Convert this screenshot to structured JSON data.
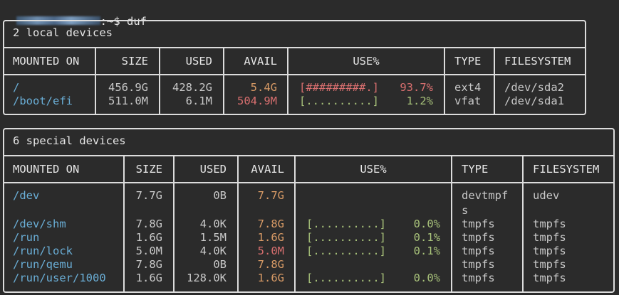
{
  "prompt": {
    "suffix": ":~$ duf"
  },
  "local": {
    "title": "2 local devices",
    "headers": [
      "MOUNTED ON",
      "SIZE",
      "USED",
      "AVAIL",
      "USE%",
      "TYPE",
      "FILESYSTEM"
    ],
    "rows": [
      {
        "mount": "/",
        "size": "456.9G",
        "used": "428.2G",
        "avail": "5.4G",
        "bar": "[#########.]",
        "pct": "93.7%",
        "type": "ext4",
        "fs": "/dev/sda2"
      },
      {
        "mount": "/boot/efi",
        "size": "511.0M",
        "used": "6.1M",
        "avail": "504.9M",
        "bar": "[..........]",
        "pct": "1.2%",
        "type": "vfat",
        "fs": "/dev/sda1"
      }
    ]
  },
  "special": {
    "title": "6 special devices",
    "headers": [
      "MOUNTED ON",
      "SIZE",
      "USED",
      "AVAIL",
      "USE%",
      "TYPE",
      "FILESYSTEM"
    ],
    "rows": [
      {
        "mount": "/dev",
        "size": "7.7G",
        "used": "0B",
        "avail": "7.7G",
        "bar": "",
        "pct": "",
        "type": "devtmpf",
        "type2": "s",
        "fs": "udev"
      },
      {
        "mount": "/dev/shm",
        "size": "7.8G",
        "used": "4.0K",
        "avail": "7.8G",
        "bar": "[..........]",
        "pct": "0.0%",
        "type": "tmpfs",
        "fs": "tmpfs"
      },
      {
        "mount": "/run",
        "size": "1.6G",
        "used": "1.5M",
        "avail": "1.6G",
        "bar": "[..........]",
        "pct": "0.1%",
        "type": "tmpfs",
        "fs": "tmpfs"
      },
      {
        "mount": "/run/lock",
        "size": "5.0M",
        "used": "4.0K",
        "avail": "5.0M",
        "bar": "[..........]",
        "pct": "0.1%",
        "type": "tmpfs",
        "fs": "tmpfs"
      },
      {
        "mount": "/run/qemu",
        "size": "7.8G",
        "used": "0B",
        "avail": "7.8G",
        "bar": "",
        "pct": "",
        "type": "tmpfs",
        "fs": "tmpfs"
      },
      {
        "mount": "/run/user/1000",
        "size": "1.6G",
        "used": "128.0K",
        "avail": "1.6G",
        "bar": "[..........]",
        "pct": "0.0%",
        "type": "tmpfs",
        "fs": "tmpfs"
      }
    ]
  },
  "colors": {
    "mount": "#6aaed6",
    "avail_ok": "#d99b66",
    "avail_low": "#d86f6f",
    "bar_ok": "#a8c27a",
    "bar_high": "#d86f6f"
  }
}
